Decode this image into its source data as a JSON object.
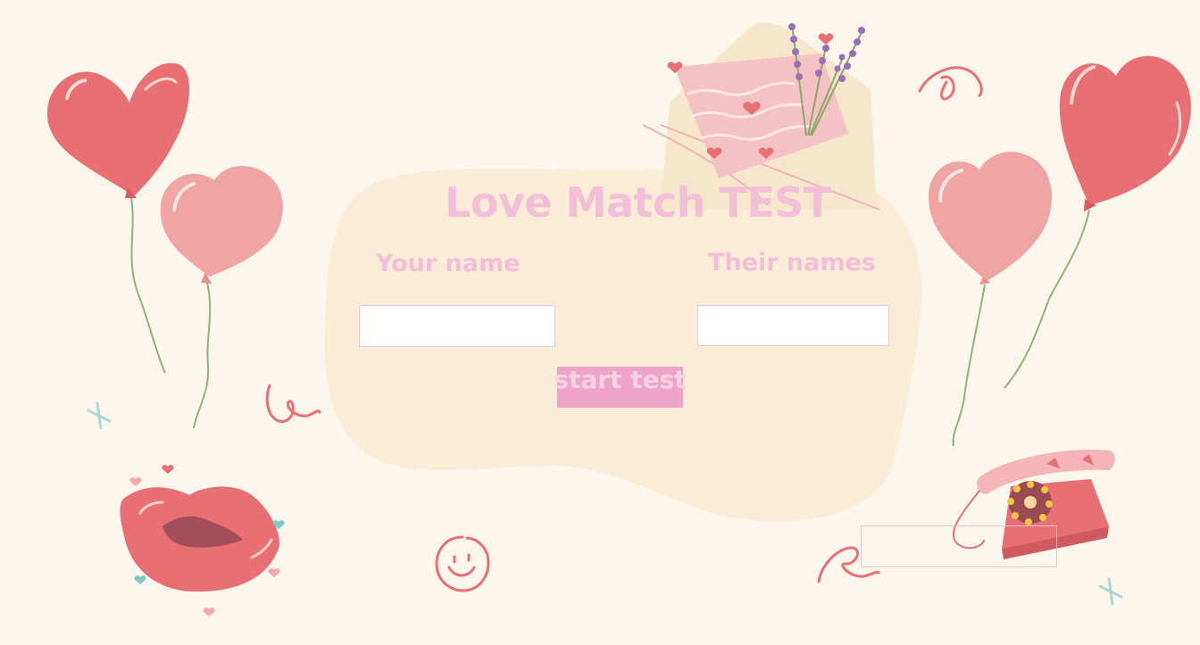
{
  "app": {
    "title": "Love Match TEST"
  },
  "form": {
    "your_name_label": "Your name",
    "their_names_label": "Their names",
    "your_name_value": "",
    "their_names_value": "",
    "start_button_label": "start test"
  },
  "result": {
    "text": ""
  },
  "decorations": {
    "icons": [
      "heart-balloon-icon",
      "heart-balloon-icon",
      "heart-balloon-icon",
      "heart-balloon-icon",
      "love-letter-icon",
      "lavender-icon",
      "lips-icon",
      "smiley-icon",
      "telephone-icon",
      "squiggle-icon",
      "sparkle-cross-icon"
    ]
  },
  "colors": {
    "background": "#fdf6ec",
    "blob": "#fbecd8",
    "title_pink": "#f3bfd8",
    "button": "#eea3c8",
    "balloon_red": "#e86f74",
    "balloon_pink": "#efa5a4"
  }
}
